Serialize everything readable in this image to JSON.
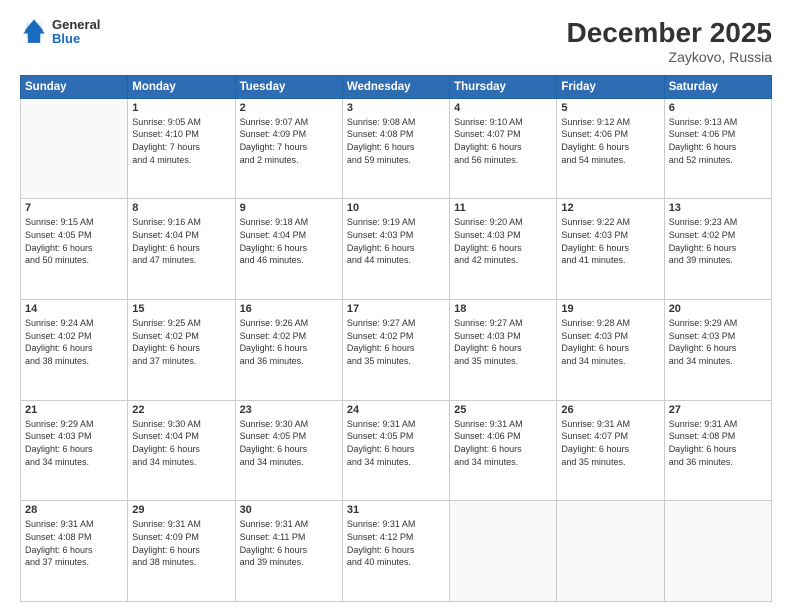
{
  "header": {
    "logo": {
      "general": "General",
      "blue": "Blue"
    },
    "title": "December 2025",
    "subtitle": "Zaykovo, Russia"
  },
  "weekdays": [
    "Sunday",
    "Monday",
    "Tuesday",
    "Wednesday",
    "Thursday",
    "Friday",
    "Saturday"
  ],
  "weeks": [
    [
      {
        "day": "",
        "info": ""
      },
      {
        "day": "1",
        "info": "Sunrise: 9:05 AM\nSunset: 4:10 PM\nDaylight: 7 hours\nand 4 minutes."
      },
      {
        "day": "2",
        "info": "Sunrise: 9:07 AM\nSunset: 4:09 PM\nDaylight: 7 hours\nand 2 minutes."
      },
      {
        "day": "3",
        "info": "Sunrise: 9:08 AM\nSunset: 4:08 PM\nDaylight: 6 hours\nand 59 minutes."
      },
      {
        "day": "4",
        "info": "Sunrise: 9:10 AM\nSunset: 4:07 PM\nDaylight: 6 hours\nand 56 minutes."
      },
      {
        "day": "5",
        "info": "Sunrise: 9:12 AM\nSunset: 4:06 PM\nDaylight: 6 hours\nand 54 minutes."
      },
      {
        "day": "6",
        "info": "Sunrise: 9:13 AM\nSunset: 4:06 PM\nDaylight: 6 hours\nand 52 minutes."
      }
    ],
    [
      {
        "day": "7",
        "info": "Sunrise: 9:15 AM\nSunset: 4:05 PM\nDaylight: 6 hours\nand 50 minutes."
      },
      {
        "day": "8",
        "info": "Sunrise: 9:16 AM\nSunset: 4:04 PM\nDaylight: 6 hours\nand 47 minutes."
      },
      {
        "day": "9",
        "info": "Sunrise: 9:18 AM\nSunset: 4:04 PM\nDaylight: 6 hours\nand 46 minutes."
      },
      {
        "day": "10",
        "info": "Sunrise: 9:19 AM\nSunset: 4:03 PM\nDaylight: 6 hours\nand 44 minutes."
      },
      {
        "day": "11",
        "info": "Sunrise: 9:20 AM\nSunset: 4:03 PM\nDaylight: 6 hours\nand 42 minutes."
      },
      {
        "day": "12",
        "info": "Sunrise: 9:22 AM\nSunset: 4:03 PM\nDaylight: 6 hours\nand 41 minutes."
      },
      {
        "day": "13",
        "info": "Sunrise: 9:23 AM\nSunset: 4:02 PM\nDaylight: 6 hours\nand 39 minutes."
      }
    ],
    [
      {
        "day": "14",
        "info": "Sunrise: 9:24 AM\nSunset: 4:02 PM\nDaylight: 6 hours\nand 38 minutes."
      },
      {
        "day": "15",
        "info": "Sunrise: 9:25 AM\nSunset: 4:02 PM\nDaylight: 6 hours\nand 37 minutes."
      },
      {
        "day": "16",
        "info": "Sunrise: 9:26 AM\nSunset: 4:02 PM\nDaylight: 6 hours\nand 36 minutes."
      },
      {
        "day": "17",
        "info": "Sunrise: 9:27 AM\nSunset: 4:02 PM\nDaylight: 6 hours\nand 35 minutes."
      },
      {
        "day": "18",
        "info": "Sunrise: 9:27 AM\nSunset: 4:03 PM\nDaylight: 6 hours\nand 35 minutes."
      },
      {
        "day": "19",
        "info": "Sunrise: 9:28 AM\nSunset: 4:03 PM\nDaylight: 6 hours\nand 34 minutes."
      },
      {
        "day": "20",
        "info": "Sunrise: 9:29 AM\nSunset: 4:03 PM\nDaylight: 6 hours\nand 34 minutes."
      }
    ],
    [
      {
        "day": "21",
        "info": "Sunrise: 9:29 AM\nSunset: 4:03 PM\nDaylight: 6 hours\nand 34 minutes."
      },
      {
        "day": "22",
        "info": "Sunrise: 9:30 AM\nSunset: 4:04 PM\nDaylight: 6 hours\nand 34 minutes."
      },
      {
        "day": "23",
        "info": "Sunrise: 9:30 AM\nSunset: 4:05 PM\nDaylight: 6 hours\nand 34 minutes."
      },
      {
        "day": "24",
        "info": "Sunrise: 9:31 AM\nSunset: 4:05 PM\nDaylight: 6 hours\nand 34 minutes."
      },
      {
        "day": "25",
        "info": "Sunrise: 9:31 AM\nSunset: 4:06 PM\nDaylight: 6 hours\nand 34 minutes."
      },
      {
        "day": "26",
        "info": "Sunrise: 9:31 AM\nSunset: 4:07 PM\nDaylight: 6 hours\nand 35 minutes."
      },
      {
        "day": "27",
        "info": "Sunrise: 9:31 AM\nSunset: 4:08 PM\nDaylight: 6 hours\nand 36 minutes."
      }
    ],
    [
      {
        "day": "28",
        "info": "Sunrise: 9:31 AM\nSunset: 4:08 PM\nDaylight: 6 hours\nand 37 minutes."
      },
      {
        "day": "29",
        "info": "Sunrise: 9:31 AM\nSunset: 4:09 PM\nDaylight: 6 hours\nand 38 minutes."
      },
      {
        "day": "30",
        "info": "Sunrise: 9:31 AM\nSunset: 4:11 PM\nDaylight: 6 hours\nand 39 minutes."
      },
      {
        "day": "31",
        "info": "Sunrise: 9:31 AM\nSunset: 4:12 PM\nDaylight: 6 hours\nand 40 minutes."
      },
      {
        "day": "",
        "info": ""
      },
      {
        "day": "",
        "info": ""
      },
      {
        "day": "",
        "info": ""
      }
    ]
  ]
}
